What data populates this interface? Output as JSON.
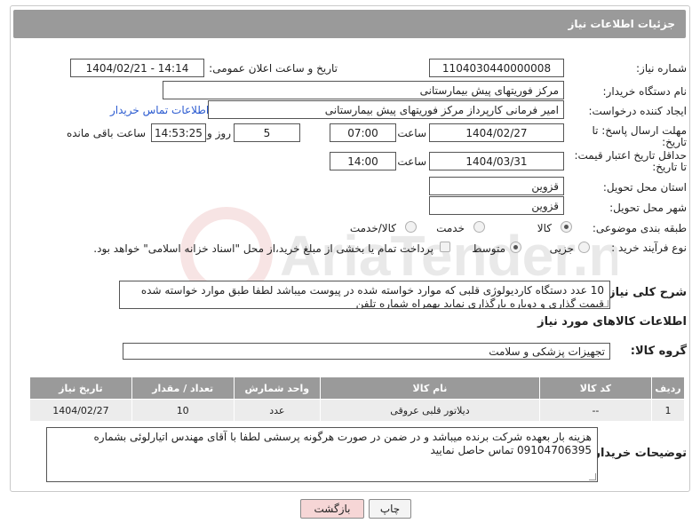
{
  "header": {
    "title": "جزئیات اطلاعات نیاز"
  },
  "labels": {
    "need_number": "شماره نیاز:",
    "announce_datetime": "تاریخ و ساعت اعلان عمومی:",
    "buyer_org": "نام دستگاه خریدار:",
    "creator": "ایجاد کننده درخواست:",
    "reply_deadline_line1": "مهلت ارسال پاسخ: تا",
    "reply_deadline_line2": "تاریخ:",
    "price_validity_line1": "حداقل تاریخ اعتبار قیمت:",
    "price_validity_line2": "تا تاریخ:",
    "hour": "ساعت",
    "day_and": "روز و",
    "hours_remaining": "ساعت باقی مانده",
    "province": "استان محل تحویل:",
    "city": "شهر محل تحویل:",
    "category": "طبقه بندی موضوعی:",
    "purchase_type": "نوع فرآیند خرید :",
    "description": "شرح کلی نیاز:",
    "items_info": "اطلاعات کالاهای مورد نیاز",
    "goods_group": "گروه کالا:",
    "buyer_notes": "توضیحات خریدار:"
  },
  "fields": {
    "need_number": "1104030440000008",
    "announce_datetime": "1404/02/21 - 14:14",
    "buyer_org": "مرکز فوریتهای پیش بیمارستانی",
    "creator": "امیر فرمانی کارپرداز مرکز فوریتهای پیش بیمارستانی",
    "contact_link": "اطلاعات تماس خریدار",
    "reply_date": "1404/02/27",
    "reply_time": "07:00",
    "reply_days": "5",
    "remaining_time": "14:53:25",
    "validity_date": "1404/03/31",
    "validity_time": "14:00",
    "province": "قزوین",
    "city": "قزوین"
  },
  "category_options": [
    {
      "label": "کالا",
      "selected": true
    },
    {
      "label": "خدمت",
      "selected": false
    },
    {
      "label": "کالا/خدمت",
      "selected": false
    }
  ],
  "purchase_options": [
    {
      "label": "جزیی",
      "selected": false
    },
    {
      "label": "متوسط",
      "selected": true
    }
  ],
  "payment_note": "پرداخت تمام یا بخشی از مبلغ خرید،از محل \"اسناد خزانه اسلامی\" خواهد بود.",
  "description": "10 عدد دستگاه کاردیولوژی قلبی که موارد خواسته شده در پیوست میباشد لطفا طبق موارد خواسته شده قیمت گذاری و دوباره بارگذاری نماید بهمراه شماره تلفن",
  "goods_group": "تجهیزات پزشکی و سلامت",
  "table": {
    "columns": [
      "ردیف",
      "کد کالا",
      "نام کالا",
      "واحد شمارش",
      "تعداد / مقدار",
      "تاریخ نیاز"
    ],
    "rows": [
      [
        "1",
        "--",
        "دیلاتور قلبی عروقی",
        "عدد",
        "10",
        "1404/02/27"
      ]
    ]
  },
  "buyer_notes": "هزینه بار بعهده شرکت برنده میباشد و در ضمن در صورت هرگونه پرسشی لطفا با آقای مهندس اتیارلوئی بشماره 09104706395 تماس حاصل نمایید",
  "buttons": {
    "print": "چاپ",
    "back": "بازگشت"
  },
  "watermark_text": "AriaTender.neT",
  "colors": {
    "header_bg": "#9a9a9a",
    "link": "#2a5ad0",
    "back_button_bg": "#f6d6d6"
  }
}
